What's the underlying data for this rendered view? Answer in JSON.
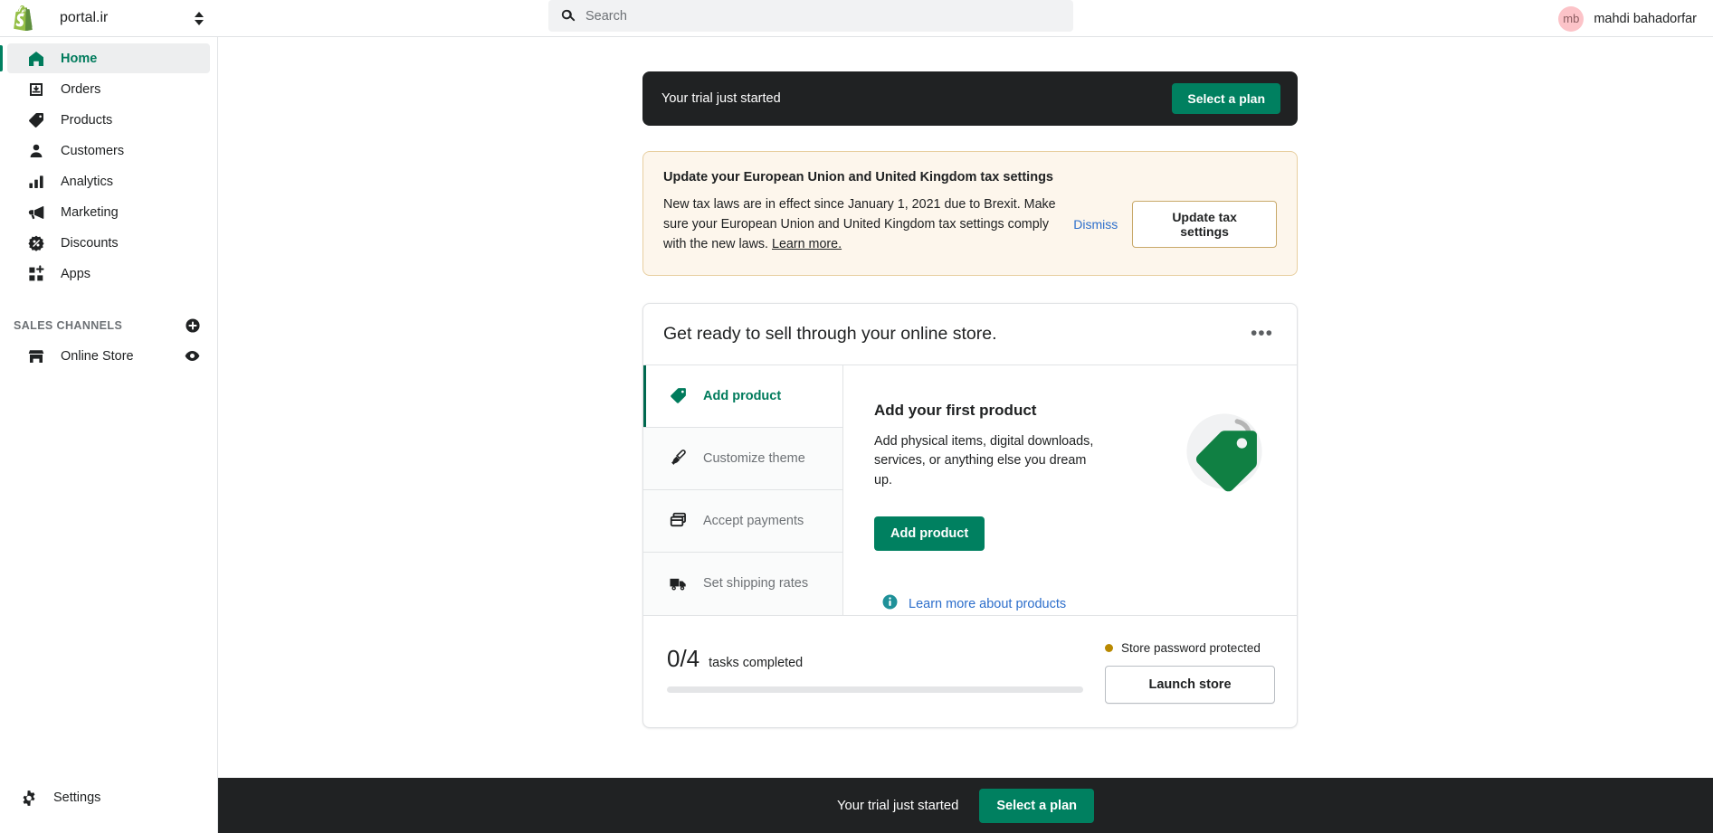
{
  "topbar": {
    "store_name": "portal.ir",
    "logo_icon": "shopify-bag-icon",
    "switcher_icon": "sort-updown-icon",
    "search": {
      "icon": "search-icon",
      "placeholder": "Search",
      "value": ""
    },
    "user": {
      "avatar_initials": "mb",
      "avatar_color": "#fcc3c8",
      "name": "mahdi bahadorfar"
    }
  },
  "sidebar": {
    "items": [
      {
        "label": "Home",
        "icon": "home-icon",
        "active": true
      },
      {
        "label": "Orders",
        "icon": "orders-inbox-icon",
        "active": false
      },
      {
        "label": "Products",
        "icon": "product-tag-icon",
        "active": false
      },
      {
        "label": "Customers",
        "icon": "customer-person-icon",
        "active": false
      },
      {
        "label": "Analytics",
        "icon": "analytics-bars-icon",
        "active": false
      },
      {
        "label": "Marketing",
        "icon": "marketing-megaphone-icon",
        "active": false
      },
      {
        "label": "Discounts",
        "icon": "discount-badge-icon",
        "active": false
      },
      {
        "label": "Apps",
        "icon": "apps-grid-plus-icon",
        "active": false
      }
    ],
    "channels": {
      "title": "SALES CHANNELS",
      "add_icon": "add-circle-icon",
      "items": [
        {
          "label": "Online Store",
          "icon": "storefront-icon",
          "action_icon": "eye-view-icon"
        }
      ]
    },
    "settings": {
      "label": "Settings",
      "icon": "gear-icon"
    }
  },
  "trial_banner": {
    "text": "Your trial just started",
    "button": "Select a plan"
  },
  "tax_banner": {
    "title": "Update your European Union and United Kingdom tax settings",
    "body_part1": "New tax laws are in effect since January 1, 2021 due to Brexit. Make sure your European Union and United Kingdom tax settings comply with the new laws. ",
    "learn_more": "Learn more.",
    "dismiss": "Dismiss",
    "update_button": "Update tax settings"
  },
  "setup_card": {
    "title": "Get ready to sell through your online store.",
    "more_icon": "ellipsis-horizontal-icon",
    "tasks": [
      {
        "label": "Add product",
        "icon": "product-tag-icon",
        "active": true
      },
      {
        "label": "Customize theme",
        "icon": "paintbrush-icon",
        "active": false
      },
      {
        "label": "Accept payments",
        "icon": "payments-card-icon",
        "active": false
      },
      {
        "label": "Set shipping rates",
        "icon": "shipping-truck-icon",
        "active": false
      }
    ],
    "detail": {
      "title": "Add your first product",
      "description": "Add physical items, digital downloads, services, or anything else you dream up.",
      "button": "Add product",
      "illustration_icon": "product-tag-illustration",
      "learn_icon": "info-circle-icon",
      "learn_label": "Learn more about products"
    },
    "footer": {
      "progress_count": "0/4",
      "progress_caption": "tasks completed",
      "progress_percent": 0,
      "status_label": "Store password protected",
      "status_dot_color": "#b98900",
      "launch_button": "Launch store"
    }
  },
  "bottom_bar": {
    "text": "Your trial just started",
    "button": "Select a plan"
  },
  "colors": {
    "accent_green": "#008060",
    "dark": "#202223",
    "link_blue": "#2c6ecb",
    "warn_bg": "#fdf6ec",
    "warn_border": "#e8cfa0"
  }
}
